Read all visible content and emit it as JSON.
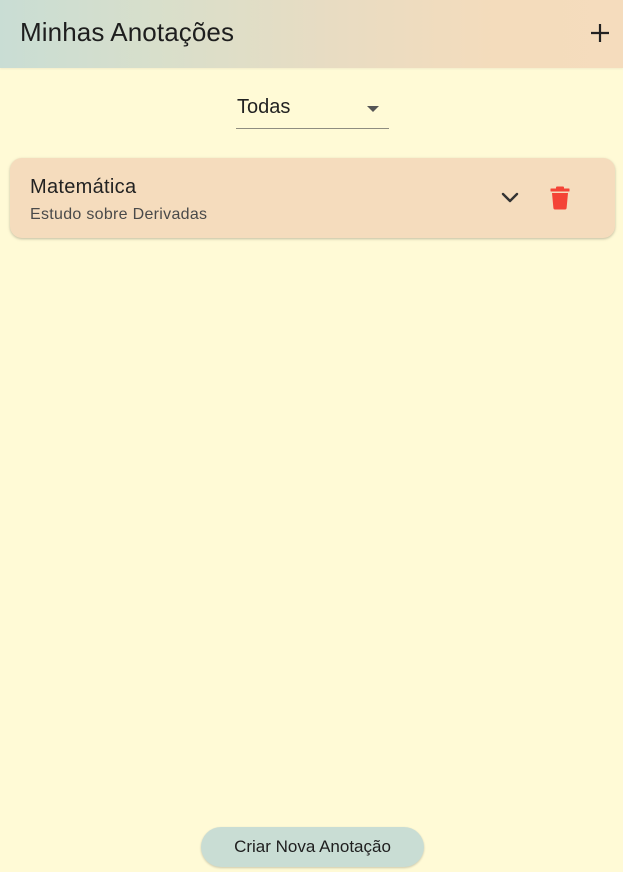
{
  "appbar": {
    "title": "Minhas Anotações",
    "add_icon": "plus-icon"
  },
  "filter": {
    "selected": "Todas",
    "icon": "caret-down-icon"
  },
  "notes": [
    {
      "title": "Matemática",
      "subtitle": "Estudo sobre Derivadas",
      "expand_icon": "chevron-down-icon",
      "delete_icon": "trash-icon"
    }
  ],
  "footer": {
    "create_label": "Criar Nova Anotação"
  },
  "colors": {
    "background": "#fffad6",
    "appbar_start": "#c9ddd4",
    "appbar_end": "#f5dcbd",
    "card": "#f5dcbd",
    "delete": "#f44336",
    "button": "#c9ddd4"
  }
}
